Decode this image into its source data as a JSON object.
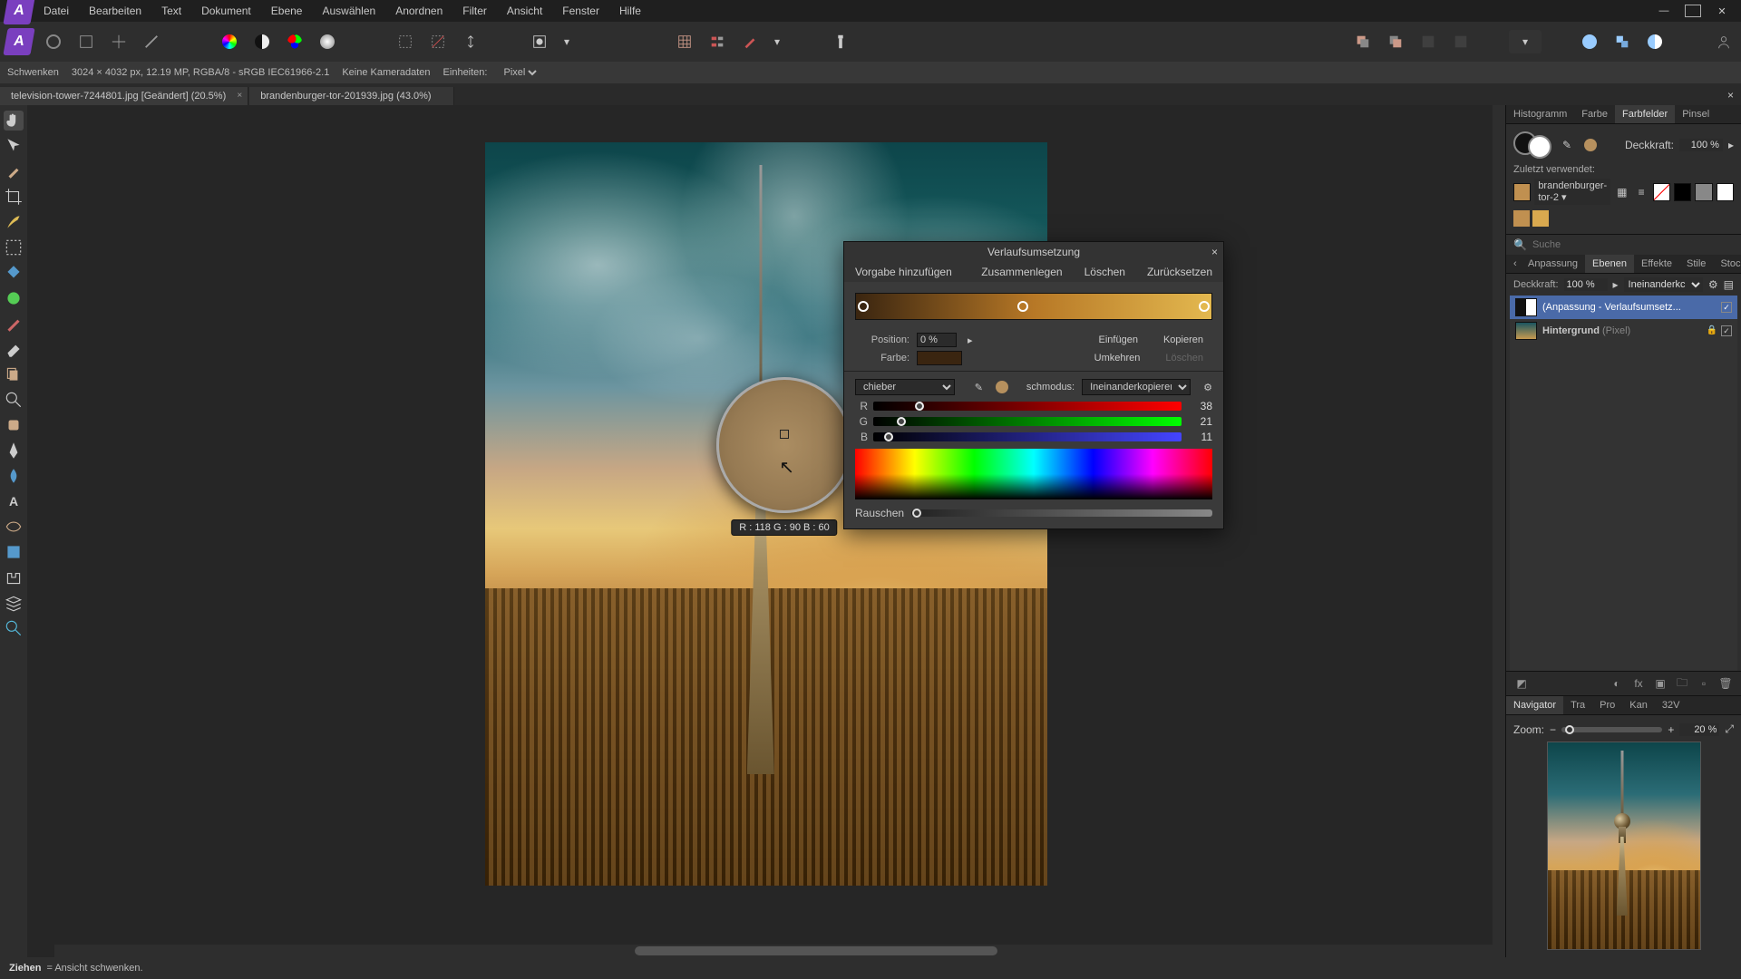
{
  "menu": {
    "items": [
      "Datei",
      "Bearbeiten",
      "Text",
      "Dokument",
      "Ebene",
      "Auswählen",
      "Anordnen",
      "Filter",
      "Ansicht",
      "Fenster",
      "Hilfe"
    ]
  },
  "context": {
    "tool": "Schwenken",
    "dims": "3024 × 4032 px, 12.19 MP, RGBA/8 - sRGB IEC61966-2.1",
    "camera": "Keine Kameradaten",
    "units_label": "Einheiten:",
    "units_value": "Pixel"
  },
  "tabs": [
    {
      "label": "television-tower-7244801.jpg [Geändert] (20.5%)",
      "active": true
    },
    {
      "label": "brandenburger-tor-201939.jpg (43.0%)",
      "active": false
    }
  ],
  "loupe": {
    "readout": "R : 118 G : 90 B : 60"
  },
  "adjust": {
    "title": "Verlaufsumsetzung",
    "add_preset": "Vorgabe hinzufügen",
    "merge": "Zusammenlegen",
    "delete": "Löschen",
    "reset": "Zurücksetzen",
    "pos_label": "Position:",
    "pos_value": "0 %",
    "color_label": "Farbe:",
    "insert": "Einfügen",
    "copy": "Kopieren",
    "invert": "Umkehren",
    "del2": "Löschen",
    "picker_mode": "chieber",
    "blend_label": "schmodus:",
    "blend_value": "Ineinanderkopieren",
    "R": 38,
    "G": 21,
    "B": 11,
    "noise_label": "Rauschen"
  },
  "right": {
    "top_tabs": [
      "Histogramm",
      "Farbe",
      "Farbfelder",
      "Pinsel"
    ],
    "top_active": "Farbfelder",
    "opacity_label": "Deckkraft:",
    "opacity_value": "100 %",
    "recent_label": "Zuletzt verwendet:",
    "swatch_name": "brandenburger-tor-2",
    "search_placeholder": "Suche",
    "mid_tabs": [
      "Anpassung",
      "Ebenen",
      "Effekte",
      "Stile",
      "Stock"
    ],
    "mid_active": "Ebenen",
    "layer_opacity_label": "Deckkraft:",
    "layer_opacity_value": "100 %",
    "layer_blend": "Ineinanderkc",
    "layers": [
      {
        "name": "(Anpassung - Verlaufsumsetz...",
        "selected": true,
        "locked": false,
        "visible": true,
        "kind": "adj"
      },
      {
        "name": "Hintergrund",
        "type": "(Pixel)",
        "selected": false,
        "locked": true,
        "visible": true,
        "kind": "img"
      }
    ],
    "nav_tabs": [
      "Navigator",
      "Tra",
      "Pro",
      "Kan",
      "32V"
    ],
    "nav_active": "Navigator",
    "zoom_label": "Zoom:",
    "zoom_value": "20 %"
  },
  "status": {
    "hint_label": "Ziehen",
    "hint_text": "= Ansicht schwenken."
  }
}
